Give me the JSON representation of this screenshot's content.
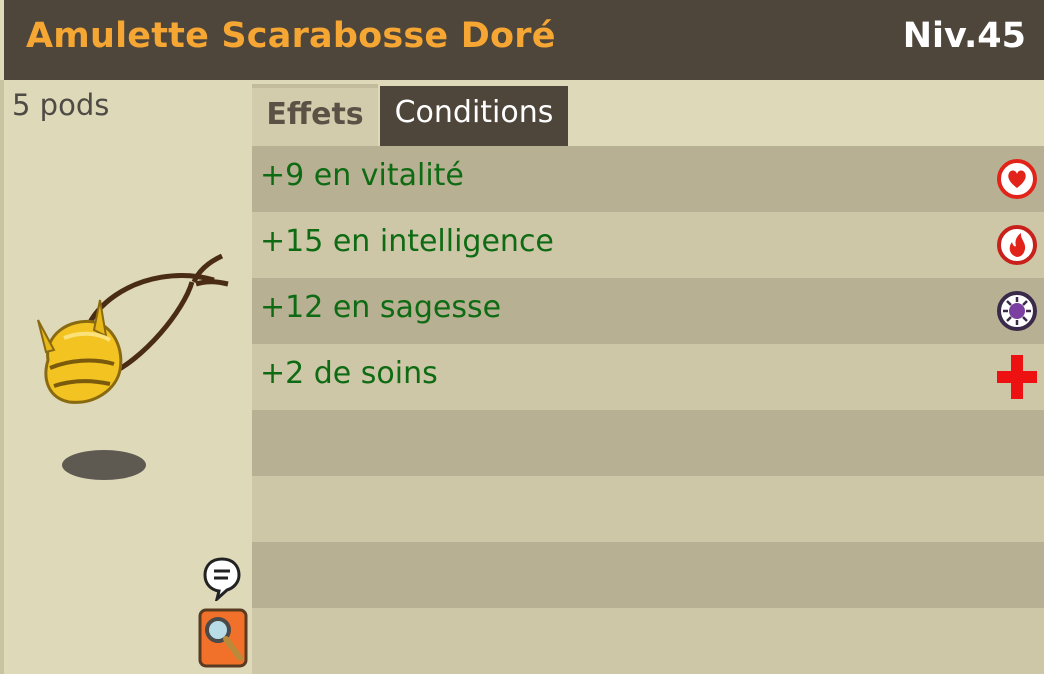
{
  "item": {
    "name": "Amulette Scarabosse Doré",
    "level": "Niv.45",
    "weight": "5 pods"
  },
  "tabs": [
    {
      "label": "Effets",
      "active": true
    },
    {
      "label": "Conditions",
      "active": false
    }
  ],
  "effects": [
    {
      "text": "+9 en vitalité",
      "icon": "vitality-heart-icon"
    },
    {
      "text": "+15 en intelligence",
      "icon": "intelligence-fire-icon"
    },
    {
      "text": "+12 en sagesse",
      "icon": "wisdom-eye-icon"
    },
    {
      "text": "+2 de soins",
      "icon": "heal-cross-icon"
    }
  ],
  "colors": {
    "title": "#f6a733",
    "effect_text": "#0f6b13",
    "header_bg": "#4f463b"
  }
}
